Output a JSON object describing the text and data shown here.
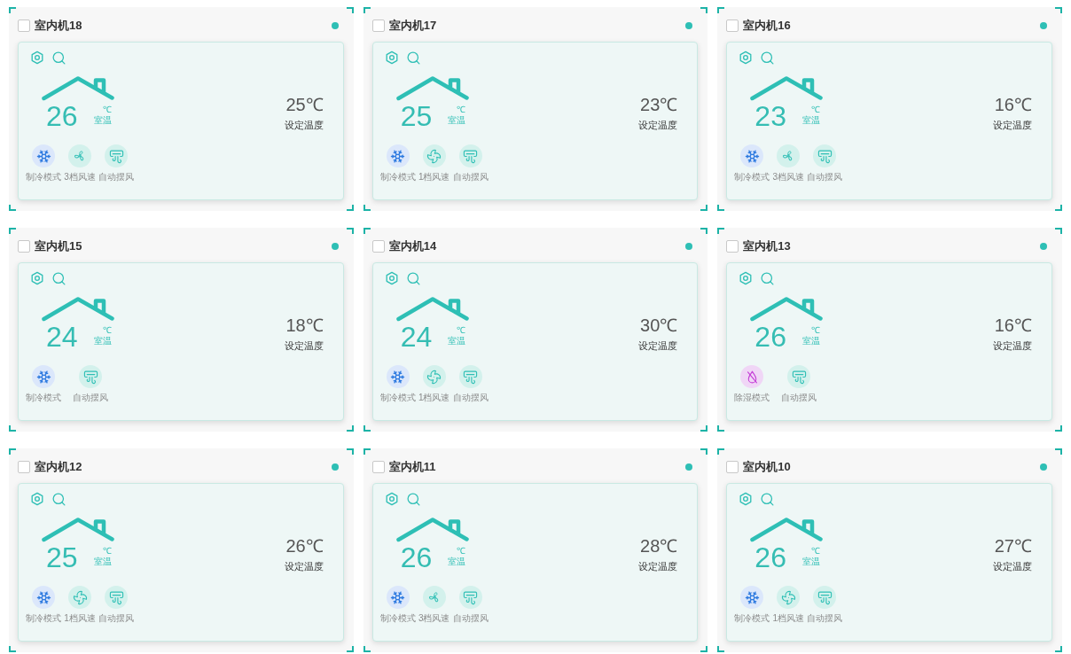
{
  "units": [
    {
      "name": "室内机18",
      "checked": false,
      "online": true,
      "room_temp": "26",
      "room_unit": "℃",
      "room_label": "室温",
      "set_temp": "25℃",
      "set_label": "设定温度",
      "modes": [
        {
          "kind": "cool",
          "label": "制冷模式"
        },
        {
          "kind": "fan3",
          "label": "3档风速"
        },
        {
          "kind": "swing",
          "label": "自动摆风"
        }
      ]
    },
    {
      "name": "室内机17",
      "checked": false,
      "online": true,
      "room_temp": "25",
      "room_unit": "℃",
      "room_label": "室温",
      "set_temp": "23℃",
      "set_label": "设定温度",
      "modes": [
        {
          "kind": "cool",
          "label": "制冷模式"
        },
        {
          "kind": "fan1",
          "label": "1档风速"
        },
        {
          "kind": "swing",
          "label": "自动摆风"
        }
      ]
    },
    {
      "name": "室内机16",
      "checked": false,
      "online": true,
      "room_temp": "23",
      "room_unit": "℃",
      "room_label": "室温",
      "set_temp": "16℃",
      "set_label": "设定温度",
      "modes": [
        {
          "kind": "cool",
          "label": "制冷模式"
        },
        {
          "kind": "fan3",
          "label": "3档风速"
        },
        {
          "kind": "swing",
          "label": "自动摆风"
        }
      ]
    },
    {
      "name": "室内机15",
      "checked": false,
      "online": true,
      "room_temp": "24",
      "room_unit": "℃",
      "room_label": "室温",
      "set_temp": "18℃",
      "set_label": "设定温度",
      "modes": [
        {
          "kind": "cool",
          "label": "制冷模式"
        },
        {
          "kind": "swing",
          "label": "自动摆风"
        }
      ]
    },
    {
      "name": "室内机14",
      "checked": false,
      "online": true,
      "room_temp": "24",
      "room_unit": "℃",
      "room_label": "室温",
      "set_temp": "30℃",
      "set_label": "设定温度",
      "modes": [
        {
          "kind": "cool",
          "label": "制冷模式"
        },
        {
          "kind": "fan1",
          "label": "1档风速"
        },
        {
          "kind": "swing",
          "label": "自动摆风"
        }
      ]
    },
    {
      "name": "室内机13",
      "checked": false,
      "online": true,
      "room_temp": "26",
      "room_unit": "℃",
      "room_label": "室温",
      "set_temp": "16℃",
      "set_label": "设定温度",
      "modes": [
        {
          "kind": "dry",
          "label": "除湿模式"
        },
        {
          "kind": "swing",
          "label": "自动摆风"
        }
      ]
    },
    {
      "name": "室内机12",
      "checked": false,
      "online": true,
      "room_temp": "25",
      "room_unit": "℃",
      "room_label": "室温",
      "set_temp": "26℃",
      "set_label": "设定温度",
      "modes": [
        {
          "kind": "cool",
          "label": "制冷模式"
        },
        {
          "kind": "fan1",
          "label": "1档风速"
        },
        {
          "kind": "swing",
          "label": "自动摆风"
        }
      ]
    },
    {
      "name": "室内机11",
      "checked": false,
      "online": true,
      "room_temp": "26",
      "room_unit": "℃",
      "room_label": "室温",
      "set_temp": "28℃",
      "set_label": "设定温度",
      "modes": [
        {
          "kind": "cool",
          "label": "制冷模式"
        },
        {
          "kind": "fan3",
          "label": "3档风速"
        },
        {
          "kind": "swing",
          "label": "自动摆风"
        }
      ]
    },
    {
      "name": "室内机10",
      "checked": false,
      "online": true,
      "room_temp": "26",
      "room_unit": "℃",
      "room_label": "室温",
      "set_temp": "27℃",
      "set_label": "设定温度",
      "modes": [
        {
          "kind": "cool",
          "label": "制冷模式"
        },
        {
          "kind": "fan1",
          "label": "1档风速"
        },
        {
          "kind": "swing",
          "label": "自动摆风"
        }
      ]
    }
  ]
}
